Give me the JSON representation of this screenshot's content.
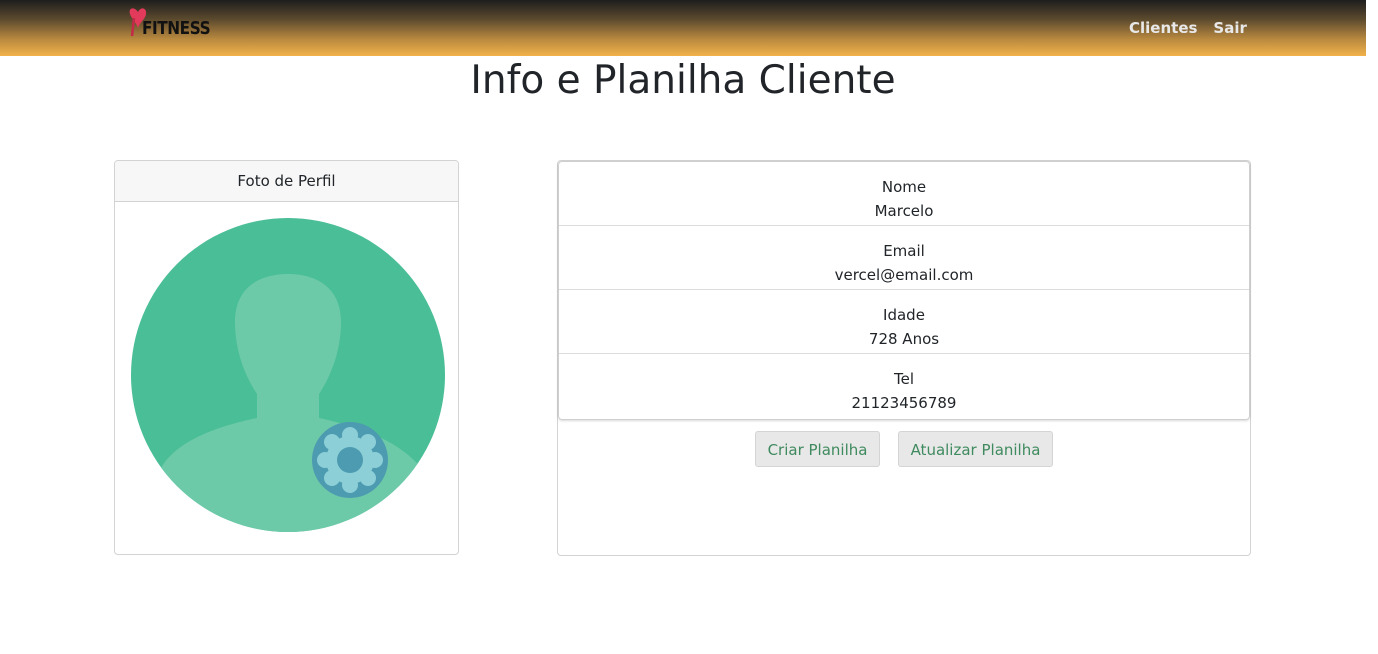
{
  "navbar": {
    "brand": "FITNESS",
    "links": [
      "Clientes",
      "Sair"
    ],
    "accent_color": "#f2b24a"
  },
  "page": {
    "title": "Info e Planilha Cliente"
  },
  "photo_card": {
    "header": "Foto de Perfil",
    "avatar_icon": "user-settings-icon"
  },
  "info_card": {
    "fields": [
      {
        "label": "Nome",
        "value": "Marcelo"
      },
      {
        "label": "Email",
        "value": "vercel@email.com"
      },
      {
        "label": "Idade",
        "value": "728 Anos"
      },
      {
        "label": "Tel",
        "value": "21123456789"
      }
    ],
    "buttons": {
      "create": "Criar Planilha",
      "update": "Atualizar Planilha"
    }
  }
}
